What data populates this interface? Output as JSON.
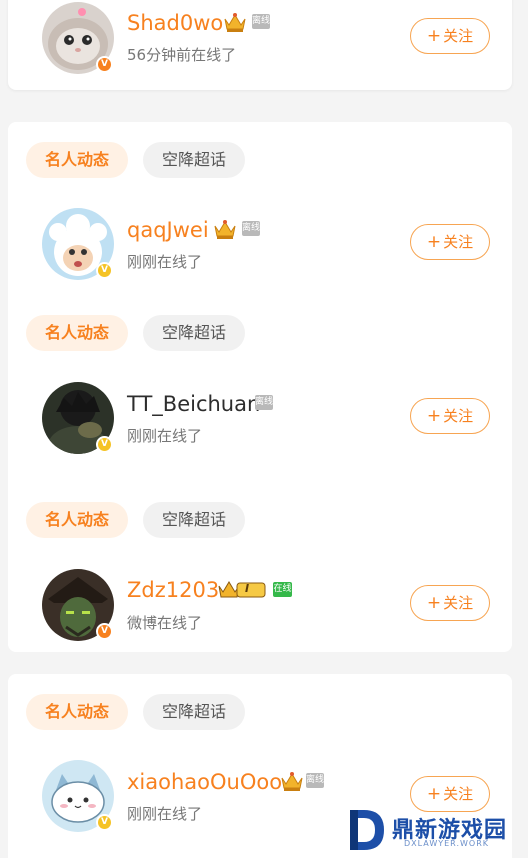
{
  "users": [
    {
      "username": "Shad0wo",
      "status": "56分钟前在线了",
      "presence": "离线",
      "verified": "V",
      "badge_color": "#f7811f",
      "follow": "关注"
    },
    {
      "username": "qaqJwei",
      "status": "刚刚在线了",
      "presence": "离线",
      "verified": "V",
      "badge_color": "#f5c326",
      "follow": "关注"
    },
    {
      "username": "TT_Beichuan",
      "status": "刚刚在线了",
      "presence": "离线",
      "verified": "V",
      "badge_color": "#f5c326",
      "follow": "关注"
    },
    {
      "username": "Zdz1203",
      "status": "微博在线了",
      "presence": "在线",
      "verified": "V",
      "level": "I",
      "badge_color": "#f7811f",
      "follow": "关注"
    },
    {
      "username": "xiaohaoOuOoo",
      "status": "刚刚在线了",
      "presence": "离线",
      "verified": "V",
      "badge_color": "#f5c326",
      "follow": "关注"
    }
  ],
  "chips": {
    "star": "名人动态",
    "super": "空降超话"
  },
  "follow_plus": "+",
  "watermark": {
    "title": "鼎新游戏园",
    "subtitle": "DXLAWYER.WORK"
  },
  "colors": {
    "accent": "#f7811f",
    "online": "#35b84a",
    "offline": "#b9b9b9"
  }
}
